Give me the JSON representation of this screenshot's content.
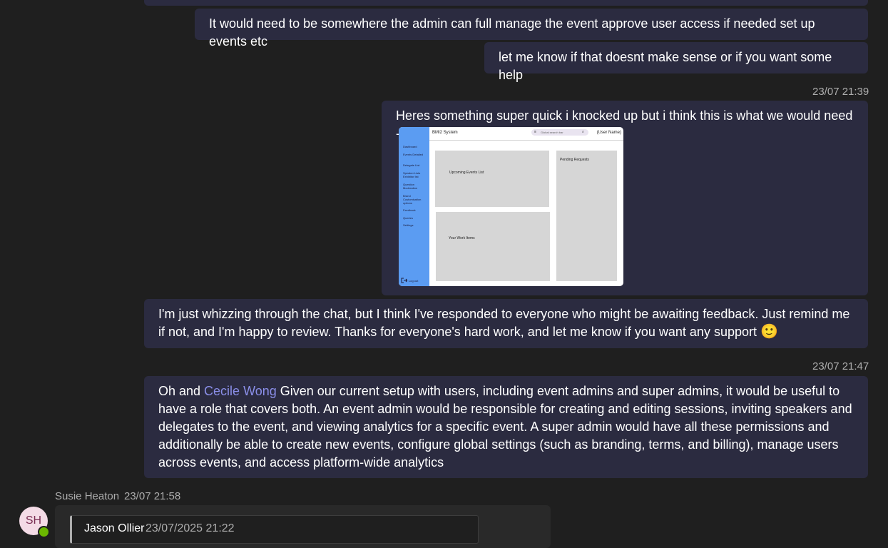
{
  "messages": {
    "m1": "It would need to be somewhere the admin can full manage the event approve user access if needed set up events etc",
    "m2": "let me know if that doesnt make sense or if you want some help",
    "ts1": "23/07 21:39",
    "m3": "Heres something super quick i knocked up but i think this is what we would need -",
    "m4": "I'm just whizzing through the chat, but I think I've responded to everyone who might be awaiting feedback. Just remind me if not, and I'm happy to review. Thanks for everyone's hard work, and let me know if you want any support",
    "m4_emoji": "🙂",
    "ts2": "23/07 21:47",
    "m5_prefix": "Oh and ",
    "m5_mention": "Cecile Wong",
    "m5_body": " Given our current setup with users, including event admins and super admins, it would be useful to have a role that covers both. An event admin would be responsible for creating and editing sessions, inviting speakers and delegates to the event, and viewing analytics for a specific event. A super admin would have all these permissions and additionally be able to create new events, configure global settings (such as branding, terms, and billing), manage users across events, and access platform-wide analytics"
  },
  "mockup": {
    "title": "BMI2 System",
    "user": "(User Name)",
    "search": "Global search bar",
    "nav": [
      "Dashboard",
      "Events Detailed",
      "Delegate List",
      "Speaker Lists Exhibitor list",
      "Question Moderation",
      "Brand Customisation options",
      "Feedback",
      "Queries",
      "Settings"
    ],
    "logout": "Log out",
    "upcoming": "Upcoming Events List",
    "work": "Your Work Items",
    "pending": "Pending Requests"
  },
  "incoming": {
    "sender": "Susie Heaton",
    "time": "23/07 21:58",
    "avatar_initials": "SH",
    "quote_author": "Jason Ollier",
    "quote_time": "23/07/2025 21:22"
  }
}
